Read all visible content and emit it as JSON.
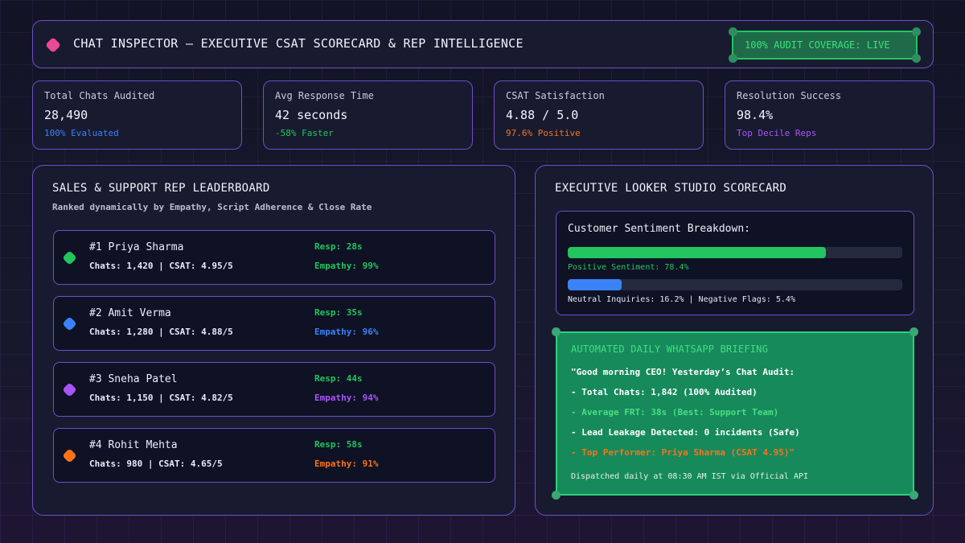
{
  "header": {
    "title": "CHAT INSPECTOR – EXECUTIVE CSAT SCORECARD & REP INTELLIGENCE",
    "badge": "100% AUDIT COVERAGE: LIVE"
  },
  "kpis": [
    {
      "label": "Total Chats Audited",
      "value": "28,490",
      "sub": "100% Evaluated",
      "sub_color": "#3b82f6"
    },
    {
      "label": "Avg Response Time",
      "value": "42 seconds",
      "sub": "-58% Faster",
      "sub_color": "#22c55e"
    },
    {
      "label": "CSAT Satisfaction",
      "value": "4.88 / 5.0",
      "sub": "97.6% Positive",
      "sub_color": "#f97316"
    },
    {
      "label": "Resolution Success",
      "value": "98.4%",
      "sub": "Top Decile Reps",
      "sub_color": "#a855f7"
    }
  ],
  "leaderboard": {
    "title": "SALES & SUPPORT REP LEADERBOARD",
    "subtitle": "Ranked dynamically by Empathy, Script Adherence & Close Rate",
    "reps": [
      {
        "name": "#1 Priya Sharma",
        "stats": "Chats: 1,420 | CSAT: 4.95/5",
        "resp": "Resp: 28s",
        "empathy": "Empathy: 99%",
        "color": "#22c55e"
      },
      {
        "name": "#2 Amit Verma",
        "stats": "Chats: 1,280 | CSAT: 4.88/5",
        "resp": "Resp: 35s",
        "empathy": "Empathy: 96%",
        "color": "#3b82f6"
      },
      {
        "name": "#3 Sneha Patel",
        "stats": "Chats: 1,150 | CSAT: 4.82/5",
        "resp": "Resp: 44s",
        "empathy": "Empathy: 94%",
        "color": "#a855f7"
      },
      {
        "name": "#4 Rohit Mehta",
        "stats": "Chats: 980 | CSAT: 4.65/5",
        "resp": "Resp: 58s",
        "empathy": "Empathy: 91%",
        "color": "#f97316"
      }
    ]
  },
  "scorecard": {
    "title": "EXECUTIVE LOOKER STUDIO SCORECARD",
    "sentiment": {
      "heading": "Customer Sentiment Breakdown:",
      "positive_fraction": 0.772,
      "positive_caption": "Positive Sentiment: 78.4%",
      "positive_color": "#22c55e",
      "neutral_fraction": 0.162,
      "neutral_caption": "Neutral Inquiries: 16.2% | Negative Flags: 5.4%",
      "neutral_color": "#3b82f6"
    },
    "whatsapp": {
      "title": "AUTOMATED DAILY WHATSAPP BRIEFING",
      "lines": [
        {
          "text": "\"Good morning CEO! Yesterday’s Chat Audit:",
          "color": "#ffffff"
        },
        {
          "text": "- Total Chats: 1,842 (100% Audited)",
          "color": "#ffffff"
        },
        {
          "text": "- Average FRT: 38s (Best: Support Team)",
          "color": "#4ade80"
        },
        {
          "text": "- Lead Leakage Detected: 0 incidents (Safe)",
          "color": "#ffffff"
        },
        {
          "text": "- Top Performer: Priya Sharma (CSAT 4.95)\"",
          "color": "#f97316"
        }
      ],
      "footer": "Dispatched daily at 08:30 AM IST via Official API"
    }
  }
}
